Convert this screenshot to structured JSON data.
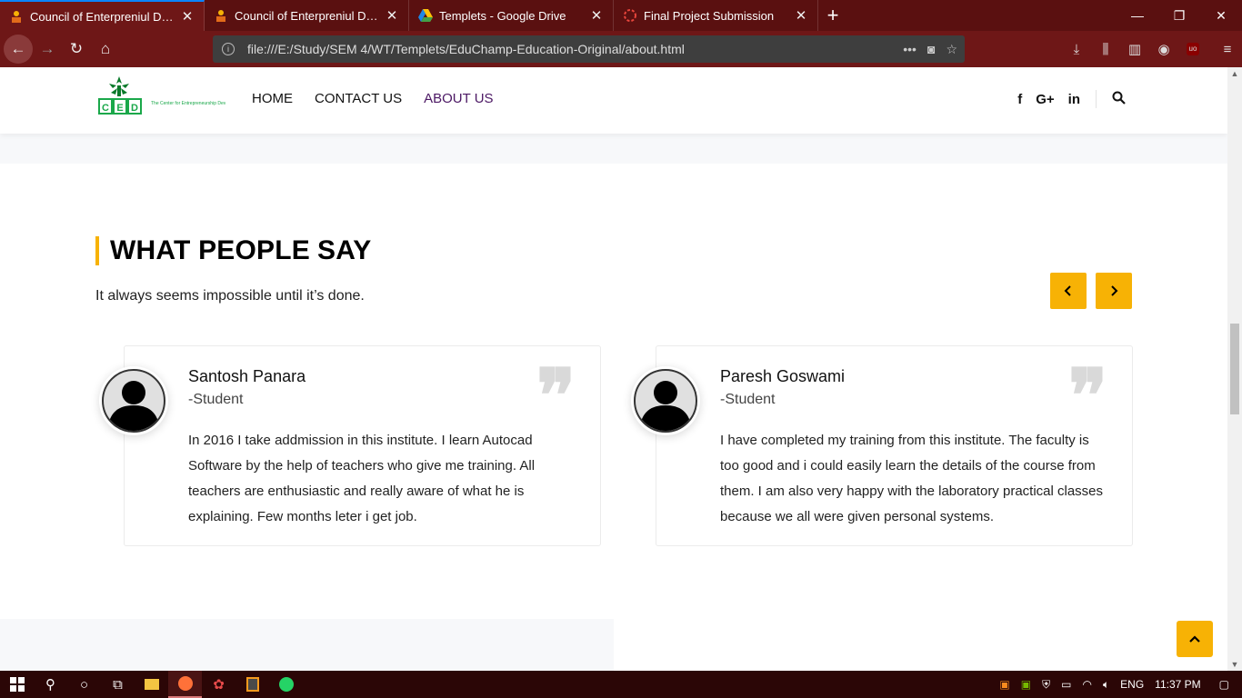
{
  "browser": {
    "tabs": [
      {
        "title": "Council of Enterpreniul Devlopment",
        "active": true
      },
      {
        "title": "Council of Enterpreniul Devlopment",
        "active": false
      },
      {
        "title": "Templets - Google Drive",
        "active": false
      },
      {
        "title": "Final Project Submission",
        "active": false
      }
    ],
    "url": "file:///E:/Study/SEM 4/WT/Templets/EduChamp-Education-Original/about.html"
  },
  "site": {
    "logo_text": "CED",
    "logo_tagline": "The Center for Entrepreneurship Development",
    "nav": [
      {
        "label": "HOME"
      },
      {
        "label": "CONTACT US"
      },
      {
        "label": "ABOUT US"
      }
    ],
    "social": [
      "f",
      "G+",
      "in"
    ]
  },
  "testimonials": {
    "title_bold": "WHAT PEOPLE",
    "title_light": "SAY",
    "subtitle": "It always seems impossible until it’s done.",
    "items": [
      {
        "name": "Santosh Panara",
        "role": "-Student",
        "text": "In 2016 I take addmission in this institute. I learn Autocad Software by the help of teachers who give me training. All teachers are enthusiastic and really aware of what he is explaining. Few months leter i get job."
      },
      {
        "name": "Paresh Goswami",
        "role": "-Student",
        "text": "I have completed my training from this institute. The faculty is too good and i could easily learn the details of the course from them. I am also very happy with the laboratory practical classes because we all were given personal systems."
      }
    ]
  },
  "taskbar": {
    "language": "ENG",
    "time": "11:37 PM"
  },
  "colors": {
    "accent": "#f7b205",
    "nav_active": "#4c1864",
    "tabbar": "#5a1010"
  }
}
